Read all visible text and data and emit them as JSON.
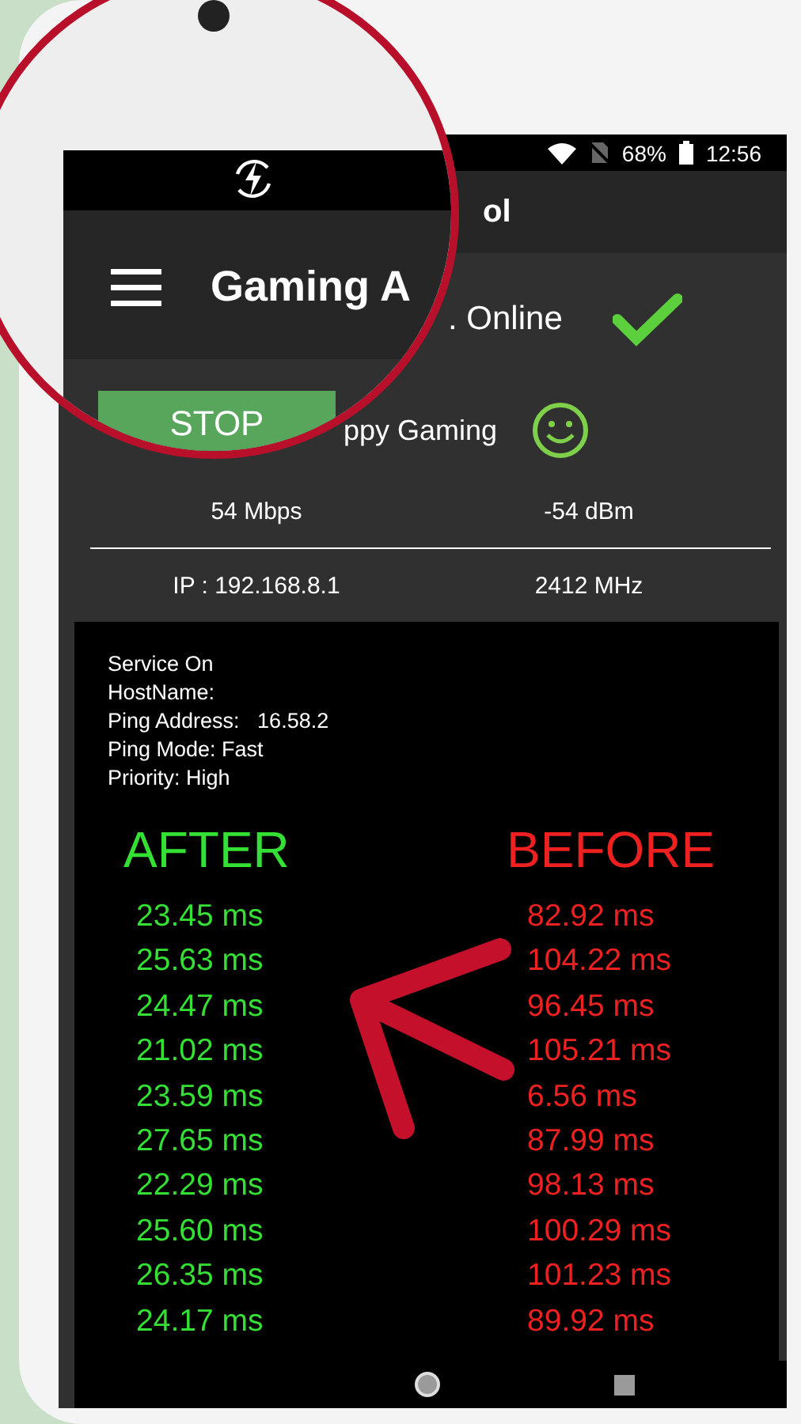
{
  "magnifier": {
    "title": "Gaming A",
    "button": "STOP"
  },
  "status_bar": {
    "battery": "68%",
    "time": "12:56"
  },
  "toolbar": {
    "title_fragment": "ol"
  },
  "connection": {
    "text": ". Online"
  },
  "mood": {
    "text": "ppy Gaming"
  },
  "stats": [
    {
      "left": "54 Mbps",
      "right": "-54 dBm"
    },
    {
      "left": "IP : 192.168.8.1",
      "right": "2412 MHz"
    }
  ],
  "info_lines": [
    "Service On",
    "HostName:",
    "Ping Address:   16.58.2",
    "Ping Mode: Fast",
    "Priority: High"
  ],
  "columns": [
    {
      "heading": "AFTER",
      "kind": "after",
      "values": [
        "23.45 ms",
        "25.63 ms",
        "24.47 ms",
        "21.02 ms",
        "23.59 ms",
        "27.65 ms",
        "22.29 ms",
        "25.60 ms",
        "26.35 ms",
        "24.17 ms"
      ]
    },
    {
      "heading": "BEFORE",
      "kind": "before",
      "values": [
        "82.92 ms",
        "104.22 ms",
        "96.45 ms",
        "105.21 ms",
        "6.56 ms",
        "87.99 ms",
        "98.13 ms",
        "100.29 ms",
        "101.23 ms",
        "89.92 ms"
      ]
    }
  ]
}
